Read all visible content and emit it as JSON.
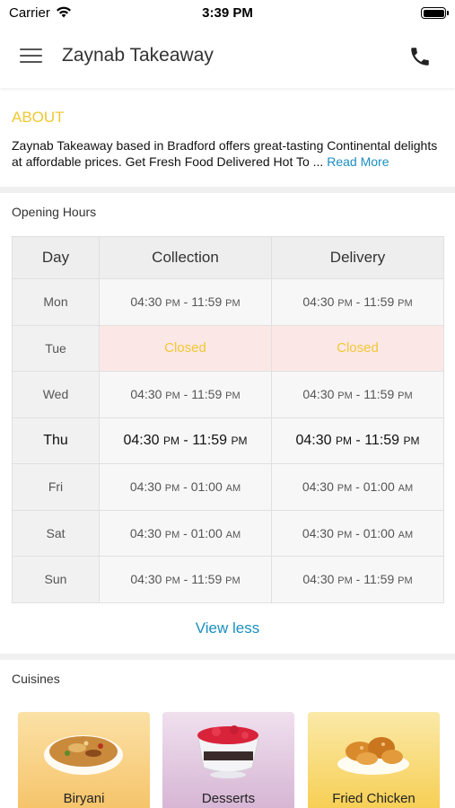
{
  "status_bar": {
    "carrier": "Carrier",
    "time": "3:39 PM",
    "icons": [
      "wifi-icon",
      "battery-icon"
    ]
  },
  "header": {
    "title": "Zaynab Takeaway",
    "icons": [
      "menu-icon",
      "phone-icon"
    ]
  },
  "about": {
    "heading": "ABOUT",
    "text": "Zaynab Takeaway based in Bradford offers great-tasting Continental delights at affordable prices. Get Fresh Food Delivered Hot To  ...",
    "read_more": "Read More"
  },
  "opening_hours": {
    "heading": "Opening Hours",
    "columns": [
      "Day",
      "Collection",
      "Delivery"
    ],
    "rows": [
      {
        "day": "Mon",
        "collection": {
          "open": "04:30",
          "open_ampm": "PM",
          "close": "11:59",
          "close_ampm": "PM"
        },
        "delivery": {
          "open": "04:30",
          "open_ampm": "PM",
          "close": "11:59",
          "close_ampm": "PM"
        }
      },
      {
        "day": "Tue",
        "closed_label": "Closed"
      },
      {
        "day": "Wed",
        "collection": {
          "open": "04:30",
          "open_ampm": "PM",
          "close": "11:59",
          "close_ampm": "PM"
        },
        "delivery": {
          "open": "04:30",
          "open_ampm": "PM",
          "close": "11:59",
          "close_ampm": "PM"
        }
      },
      {
        "day": "Thu",
        "collection": {
          "open": "04:30",
          "open_ampm": "PM",
          "close": "11:59",
          "close_ampm": "PM"
        },
        "delivery": {
          "open": "04:30",
          "open_ampm": "PM",
          "close": "11:59",
          "close_ampm": "PM"
        }
      },
      {
        "day": "Fri",
        "collection": {
          "open": "04:30",
          "open_ampm": "PM",
          "close": "01:00",
          "close_ampm": "AM"
        },
        "delivery": {
          "open": "04:30",
          "open_ampm": "PM",
          "close": "01:00",
          "close_ampm": "AM"
        }
      },
      {
        "day": "Sat",
        "collection": {
          "open": "04:30",
          "open_ampm": "PM",
          "close": "01:00",
          "close_ampm": "AM"
        },
        "delivery": {
          "open": "04:30",
          "open_ampm": "PM",
          "close": "01:00",
          "close_ampm": "AM"
        }
      },
      {
        "day": "Sun",
        "collection": {
          "open": "04:30",
          "open_ampm": "PM",
          "close": "11:59",
          "close_ampm": "PM"
        },
        "delivery": {
          "open": "04:30",
          "open_ampm": "PM",
          "close": "11:59",
          "close_ampm": "PM"
        }
      }
    ],
    "view_less": "View less"
  },
  "cuisines": {
    "heading": "Cuisines",
    "items": [
      {
        "label": "Biryani",
        "icon": "biryani-image"
      },
      {
        "label": "Desserts",
        "icon": "desserts-image"
      },
      {
        "label": "Fried Chicken",
        "icon": "fried-chicken-image"
      }
    ]
  },
  "colors": {
    "accent_yellow": "#f0c832",
    "link_blue": "#1a8fc0",
    "closed_bg": "#fce7e7"
  }
}
